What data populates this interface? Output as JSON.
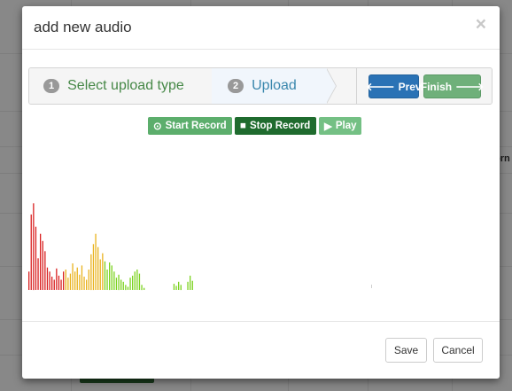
{
  "background": {
    "partial_text": "orn"
  },
  "modal": {
    "title": "add new audio",
    "close_glyph": "×"
  },
  "wizard": {
    "steps": [
      {
        "number": "1",
        "label": "Select upload type",
        "state": "complete",
        "color": "#468847"
      },
      {
        "number": "2",
        "label": "Upload",
        "state": "active",
        "color": "#3a87ad"
      }
    ],
    "prev_label": "Prev",
    "finish_label": "Finish",
    "prev_icon": "arrow-left-icon",
    "finish_icon": "arrow-right-icon"
  },
  "recorder": {
    "start_label": "Start Record",
    "stop_label": "Stop Record",
    "play_label": "Play",
    "start_icon": "record-icon",
    "stop_icon": "stop-icon",
    "play_icon": "play-icon"
  },
  "waveform": {
    "levels": [
      0.18,
      0.74,
      0.85,
      0.62,
      0.31,
      0.55,
      0.48,
      0.38,
      0.22,
      0.18,
      0.13,
      0.1,
      0.21,
      0.14,
      0.1,
      0.18,
      0.2,
      0.12,
      0.16,
      0.26,
      0.18,
      0.22,
      0.15,
      0.24,
      0.13,
      0.1,
      0.2,
      0.35,
      0.45,
      0.55,
      0.42,
      0.3,
      0.36,
      0.28,
      0.2,
      0.27,
      0.24,
      0.18,
      0.12,
      0.15,
      0.1,
      0.08,
      0.05,
      0.03,
      0.12,
      0.14,
      0.18,
      0.2,
      0.16,
      0.05,
      0.02,
      0,
      0,
      0,
      0,
      0,
      0,
      0,
      0,
      0,
      0,
      0,
      0,
      0.06,
      0.04,
      0.08,
      0.05,
      0,
      0,
      0.08,
      0.14,
      0.09
    ],
    "colors": {
      "low": "#7bd21e",
      "mid": "#e9b21d",
      "high": "#d92020"
    }
  },
  "footer": {
    "save_label": "Save",
    "cancel_label": "Cancel"
  }
}
